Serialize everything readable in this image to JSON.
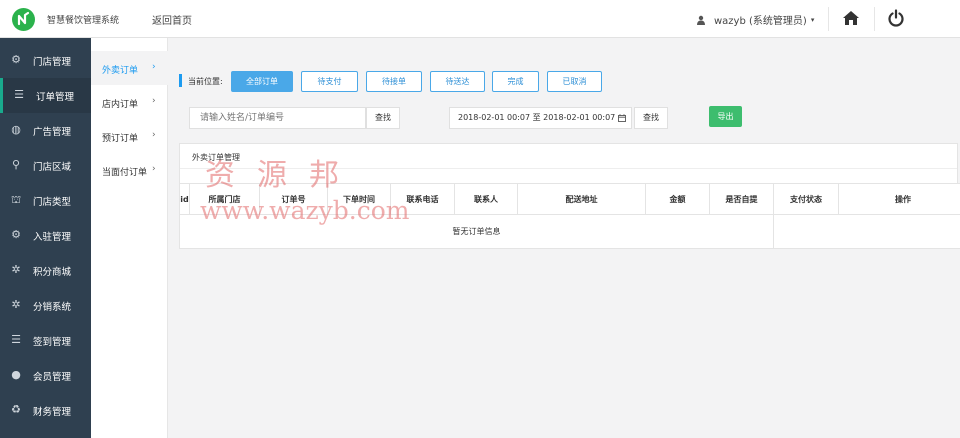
{
  "header": {
    "app_title": "智慧餐饮管理系统",
    "back_home": "返回首页",
    "user_label": "wazyb (系统管理员)",
    "caret": "▾"
  },
  "sidebar": {
    "items": [
      {
        "label": "门店管理",
        "icon": "stores-icon",
        "glyph": "⚙"
      },
      {
        "label": "订单管理",
        "icon": "list-icon",
        "glyph": "☰"
      },
      {
        "label": "广告管理",
        "icon": "globe-icon",
        "glyph": "◍"
      },
      {
        "label": "门店区域",
        "icon": "location-pin-icon",
        "glyph": "⚲"
      },
      {
        "label": "门店类型",
        "icon": "institution-icon",
        "glyph": "⛫"
      },
      {
        "label": "入驻管理",
        "icon": "cubes-icon",
        "glyph": "⚙"
      },
      {
        "label": "积分商城",
        "icon": "cog-icon",
        "glyph": "✲"
      },
      {
        "label": "分销系统",
        "icon": "cog-icon",
        "glyph": "✲"
      },
      {
        "label": "签到管理",
        "icon": "list-icon",
        "glyph": "☰"
      },
      {
        "label": "会员管理",
        "icon": "user-icon",
        "glyph": "●"
      },
      {
        "label": "财务管理",
        "icon": "recycle-icon",
        "glyph": "♻"
      }
    ]
  },
  "submenu": {
    "chevron": "›",
    "items": [
      {
        "label": "外卖订单"
      },
      {
        "label": "店内订单"
      },
      {
        "label": "预订订单"
      },
      {
        "label": "当面付订单"
      }
    ]
  },
  "breadcrumb": {
    "label": "当前位置:"
  },
  "tabs": [
    {
      "label": "全部订单"
    },
    {
      "label": "待支付"
    },
    {
      "label": "待接单"
    },
    {
      "label": "待送达"
    },
    {
      "label": "完成"
    },
    {
      "label": "已取消"
    }
  ],
  "filters": {
    "search_placeholder": "请输入姓名/订单编号",
    "search_button": "查找",
    "date_range": "2018-02-01 00:07 至 2018-02-01 00:07",
    "date_search_button": "查找",
    "export_button": "导出"
  },
  "panel": {
    "title": "外卖订单管理",
    "columns": [
      "id",
      "所属门店",
      "订单号",
      "下单时间",
      "联系电话",
      "联系人",
      "配送地址",
      "金额",
      "是否自提",
      "支付状态",
      "操作"
    ],
    "empty_message": "暂无订单信息"
  },
  "watermark": {
    "chinese": "资源邦",
    "url": "www.wazyb.com"
  },
  "colors": {
    "sidebar_bg": "#2f4050",
    "accent_blue": "#4aa8e8",
    "export_green": "#3dbd6e",
    "logo_green": "#2bb24c"
  }
}
